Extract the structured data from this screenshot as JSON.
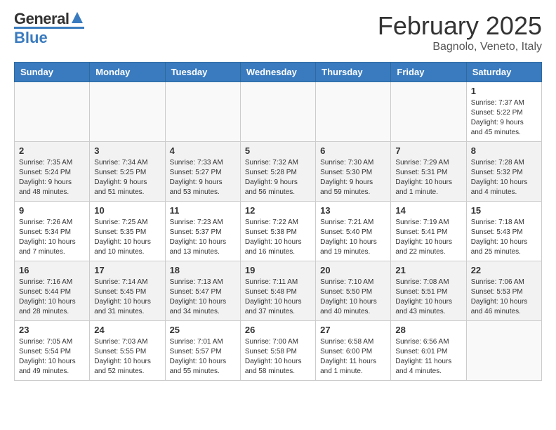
{
  "header": {
    "logo_general": "General",
    "logo_blue": "Blue",
    "month_title": "February 2025",
    "location": "Bagnolo, Veneto, Italy"
  },
  "days_of_week": [
    "Sunday",
    "Monday",
    "Tuesday",
    "Wednesday",
    "Thursday",
    "Friday",
    "Saturday"
  ],
  "weeks": [
    [
      {
        "day": "",
        "info": ""
      },
      {
        "day": "",
        "info": ""
      },
      {
        "day": "",
        "info": ""
      },
      {
        "day": "",
        "info": ""
      },
      {
        "day": "",
        "info": ""
      },
      {
        "day": "",
        "info": ""
      },
      {
        "day": "1",
        "info": "Sunrise: 7:37 AM\nSunset: 5:22 PM\nDaylight: 9 hours and 45 minutes."
      }
    ],
    [
      {
        "day": "2",
        "info": "Sunrise: 7:35 AM\nSunset: 5:24 PM\nDaylight: 9 hours and 48 minutes."
      },
      {
        "day": "3",
        "info": "Sunrise: 7:34 AM\nSunset: 5:25 PM\nDaylight: 9 hours and 51 minutes."
      },
      {
        "day": "4",
        "info": "Sunrise: 7:33 AM\nSunset: 5:27 PM\nDaylight: 9 hours and 53 minutes."
      },
      {
        "day": "5",
        "info": "Sunrise: 7:32 AM\nSunset: 5:28 PM\nDaylight: 9 hours and 56 minutes."
      },
      {
        "day": "6",
        "info": "Sunrise: 7:30 AM\nSunset: 5:30 PM\nDaylight: 9 hours and 59 minutes."
      },
      {
        "day": "7",
        "info": "Sunrise: 7:29 AM\nSunset: 5:31 PM\nDaylight: 10 hours and 1 minute."
      },
      {
        "day": "8",
        "info": "Sunrise: 7:28 AM\nSunset: 5:32 PM\nDaylight: 10 hours and 4 minutes."
      }
    ],
    [
      {
        "day": "9",
        "info": "Sunrise: 7:26 AM\nSunset: 5:34 PM\nDaylight: 10 hours and 7 minutes."
      },
      {
        "day": "10",
        "info": "Sunrise: 7:25 AM\nSunset: 5:35 PM\nDaylight: 10 hours and 10 minutes."
      },
      {
        "day": "11",
        "info": "Sunrise: 7:23 AM\nSunset: 5:37 PM\nDaylight: 10 hours and 13 minutes."
      },
      {
        "day": "12",
        "info": "Sunrise: 7:22 AM\nSunset: 5:38 PM\nDaylight: 10 hours and 16 minutes."
      },
      {
        "day": "13",
        "info": "Sunrise: 7:21 AM\nSunset: 5:40 PM\nDaylight: 10 hours and 19 minutes."
      },
      {
        "day": "14",
        "info": "Sunrise: 7:19 AM\nSunset: 5:41 PM\nDaylight: 10 hours and 22 minutes."
      },
      {
        "day": "15",
        "info": "Sunrise: 7:18 AM\nSunset: 5:43 PM\nDaylight: 10 hours and 25 minutes."
      }
    ],
    [
      {
        "day": "16",
        "info": "Sunrise: 7:16 AM\nSunset: 5:44 PM\nDaylight: 10 hours and 28 minutes."
      },
      {
        "day": "17",
        "info": "Sunrise: 7:14 AM\nSunset: 5:45 PM\nDaylight: 10 hours and 31 minutes."
      },
      {
        "day": "18",
        "info": "Sunrise: 7:13 AM\nSunset: 5:47 PM\nDaylight: 10 hours and 34 minutes."
      },
      {
        "day": "19",
        "info": "Sunrise: 7:11 AM\nSunset: 5:48 PM\nDaylight: 10 hours and 37 minutes."
      },
      {
        "day": "20",
        "info": "Sunrise: 7:10 AM\nSunset: 5:50 PM\nDaylight: 10 hours and 40 minutes."
      },
      {
        "day": "21",
        "info": "Sunrise: 7:08 AM\nSunset: 5:51 PM\nDaylight: 10 hours and 43 minutes."
      },
      {
        "day": "22",
        "info": "Sunrise: 7:06 AM\nSunset: 5:53 PM\nDaylight: 10 hours and 46 minutes."
      }
    ],
    [
      {
        "day": "23",
        "info": "Sunrise: 7:05 AM\nSunset: 5:54 PM\nDaylight: 10 hours and 49 minutes."
      },
      {
        "day": "24",
        "info": "Sunrise: 7:03 AM\nSunset: 5:55 PM\nDaylight: 10 hours and 52 minutes."
      },
      {
        "day": "25",
        "info": "Sunrise: 7:01 AM\nSunset: 5:57 PM\nDaylight: 10 hours and 55 minutes."
      },
      {
        "day": "26",
        "info": "Sunrise: 7:00 AM\nSunset: 5:58 PM\nDaylight: 10 hours and 58 minutes."
      },
      {
        "day": "27",
        "info": "Sunrise: 6:58 AM\nSunset: 6:00 PM\nDaylight: 11 hours and 1 minute."
      },
      {
        "day": "28",
        "info": "Sunrise: 6:56 AM\nSunset: 6:01 PM\nDaylight: 11 hours and 4 minutes."
      },
      {
        "day": "",
        "info": ""
      }
    ]
  ]
}
